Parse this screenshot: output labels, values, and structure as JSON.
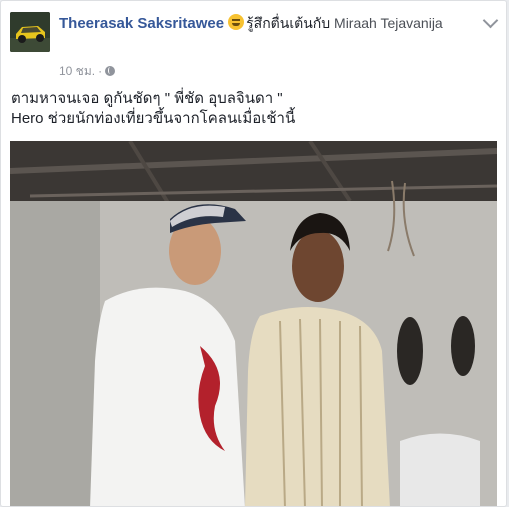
{
  "post": {
    "author": "Theerasak Saksritawee",
    "feeling_emoji": "laughing-face-icon",
    "feeling_text": "รู้สึกตื่นเต้นกับ",
    "tagged": "Miraah Tejavanija",
    "time": "10 ชม.",
    "separator": "·",
    "privacy_icon": "globe-icon",
    "text_line1": "ตามหาจนเจอ ดูกันชัดๆ \" พี่ชัด อุบลจินดา \"",
    "text_line2": "Hero ช่วยนักท่องเที่ยวขึ้นจากโคลนเมื่อเช้านี้"
  },
  "colors": {
    "link": "#365899",
    "meta": "#90949c",
    "text": "#1d2129"
  }
}
